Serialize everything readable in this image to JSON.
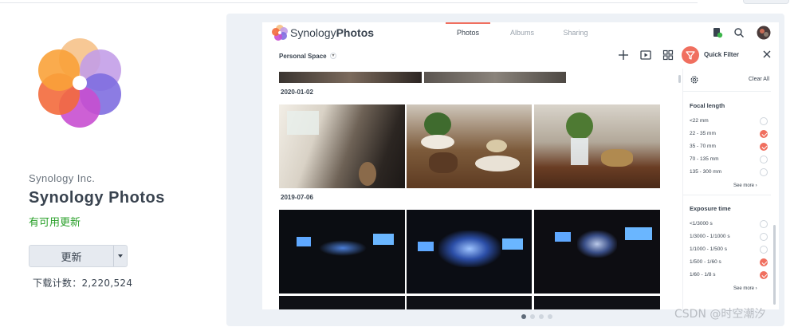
{
  "app": {
    "vendor": "Synology Inc.",
    "name": "Synology Photos",
    "status": "有可用更新",
    "update_button": "更新",
    "downloads": "下载计数：2,220,524"
  },
  "screenshot": {
    "brand_prefix": "Synology",
    "brand_suffix": "Photos",
    "tabs": [
      {
        "label": "Photos",
        "active": true
      },
      {
        "label": "Albums",
        "active": false
      },
      {
        "label": "Sharing",
        "active": false
      }
    ],
    "space": "Personal Space",
    "quick_filter": "Quick Filter",
    "clear_all": "Clear All",
    "dates": [
      "2020-01-02",
      "2019-07-06"
    ],
    "focal": {
      "title": "Focal length",
      "options": [
        {
          "label": "<22 mm",
          "checked": false
        },
        {
          "label": "22 - 35 mm",
          "checked": true
        },
        {
          "label": "35 - 70 mm",
          "checked": true
        },
        {
          "label": "70 - 135 mm",
          "checked": false
        },
        {
          "label": "135 - 300 mm",
          "checked": false
        }
      ],
      "see_more": "See more"
    },
    "exposure": {
      "title": "Exposure time",
      "options": [
        {
          "label": "<1/3000 s",
          "checked": false
        },
        {
          "label": "1/3000 - 1/1000 s",
          "checked": false
        },
        {
          "label": "1/1000 - 1/500 s",
          "checked": false
        },
        {
          "label": "1/500 - 1/60 s",
          "checked": true
        },
        {
          "label": "1/60 - 1/8 s",
          "checked": true
        }
      ],
      "see_more": "See more"
    },
    "accent_color": "#f06f5f"
  },
  "carousel": {
    "count": 4,
    "active": 0
  },
  "watermark": "CSDN @时空潮汐"
}
